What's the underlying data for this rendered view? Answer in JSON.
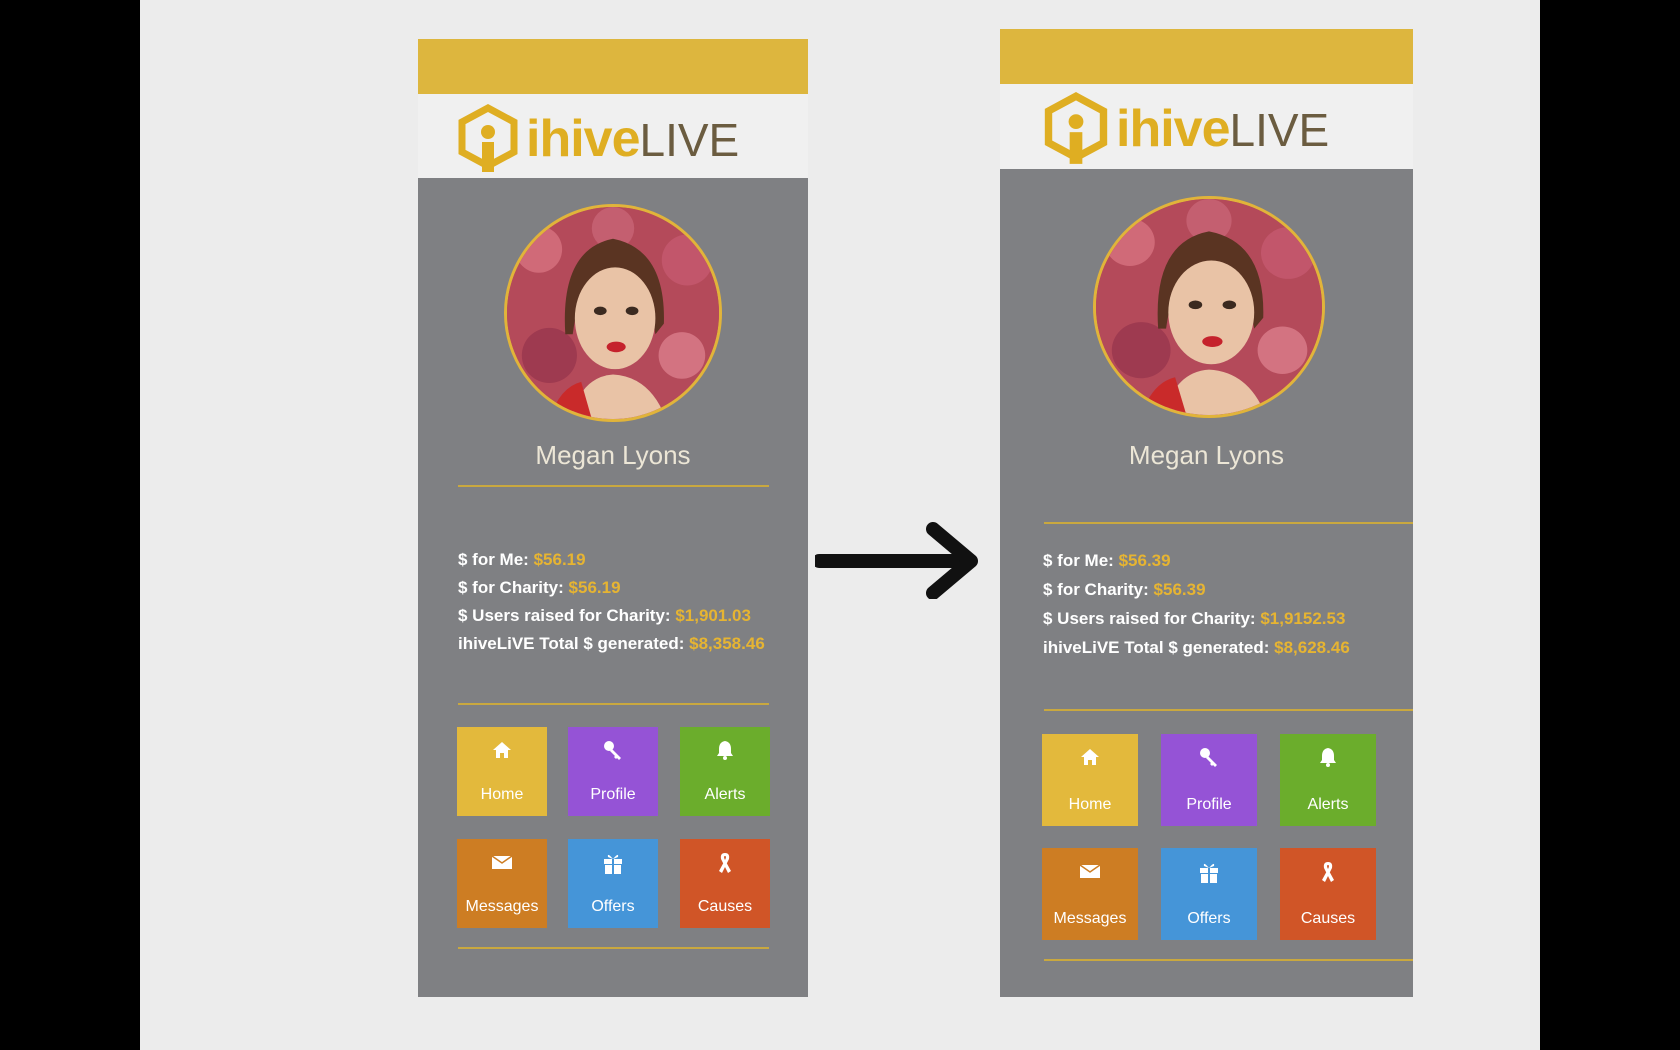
{
  "slide": {
    "before": {
      "logo": {
        "ihive": "ihive",
        "live": "LIVE"
      },
      "user_name": "Megan Lyons",
      "stats": [
        {
          "label": "$ for Me:",
          "value": "$56.19"
        },
        {
          "label": "$ for Charity:",
          "value": "$56.19"
        },
        {
          "label": "$ Users  raised for Charity:",
          "value": "$1,901.03"
        },
        {
          "label": "ihiveLiVE Total $ generated:",
          "value": "$8,358.46"
        }
      ],
      "tiles": [
        {
          "label": "Home",
          "icon": "home-icon"
        },
        {
          "label": "Profile",
          "icon": "key-icon"
        },
        {
          "label": "Alerts",
          "icon": "bell-icon"
        },
        {
          "label": "Messages",
          "icon": "envelope-icon"
        },
        {
          "label": "Offers",
          "icon": "gift-icon"
        },
        {
          "label": "Causes",
          "icon": "ribbon-icon"
        }
      ]
    },
    "after": {
      "logo": {
        "ihive": "ihive",
        "live": "LIVE"
      },
      "user_name": "Megan Lyons",
      "stats": [
        {
          "label": "$ for Me:",
          "value": "$56.39"
        },
        {
          "label": "$ for Charity:",
          "value": "$56.39"
        },
        {
          "label": "$ Users  raised for Charity:",
          "value": "$1,9152.53"
        },
        {
          "label": "ihiveLiVE Total $ generated:",
          "value": "$8,628.46"
        }
      ],
      "tiles": [
        {
          "label": "Home",
          "icon": "home-icon"
        },
        {
          "label": "Profile",
          "icon": "key-icon"
        },
        {
          "label": "Alerts",
          "icon": "bell-icon"
        },
        {
          "label": "Messages",
          "icon": "envelope-icon"
        },
        {
          "label": "Offers",
          "icon": "gift-icon"
        },
        {
          "label": "Causes",
          "icon": "ribbon-icon"
        }
      ]
    }
  },
  "colors": {
    "brand_gold": "#ddb63e",
    "panel_gray": "#7f8083",
    "home": "#e3b93c",
    "profile": "#9553d6",
    "alerts": "#6bad2c",
    "messages": "#cd7d23",
    "offers": "#4595d8",
    "causes": "#d05527"
  }
}
